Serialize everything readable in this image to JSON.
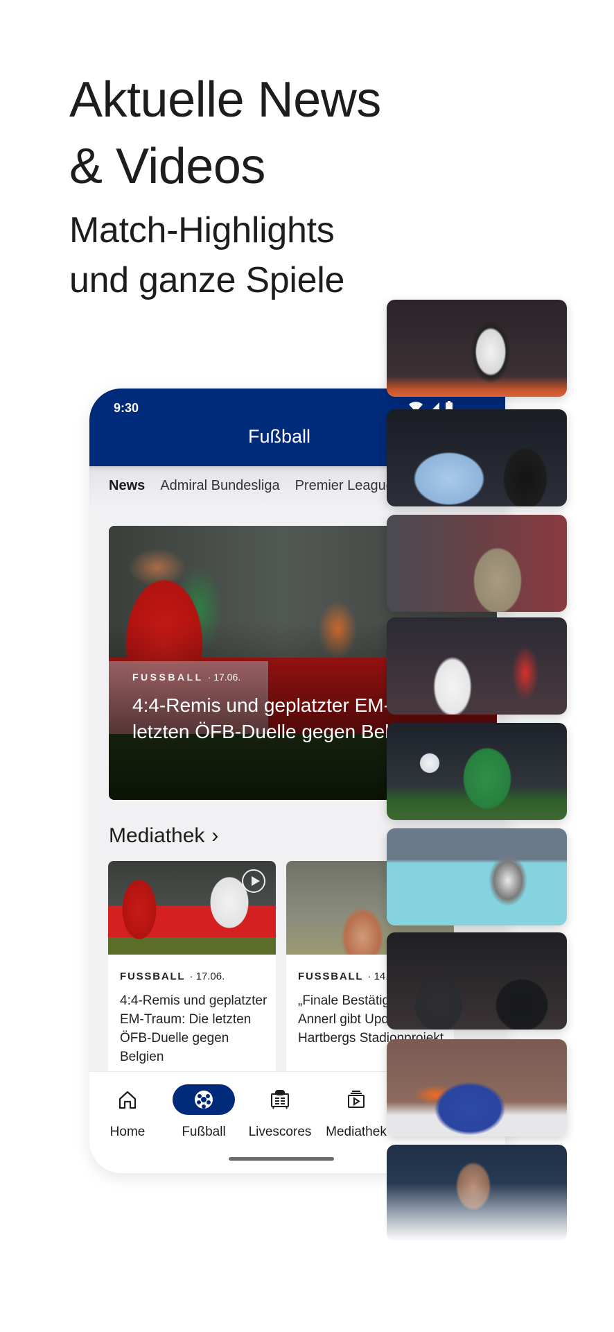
{
  "promo": {
    "title_lines": [
      "Aktuelle News",
      "& Videos"
    ],
    "subtitle_lines": [
      "Match-Highlights",
      "und ganze Spiele"
    ]
  },
  "phone": {
    "status_time": "9:30",
    "status_icons": [
      "wifi-icon",
      "signal-icon",
      "battery-icon"
    ],
    "header_title": "Fußball",
    "tabs": [
      {
        "label": "News",
        "active": true
      },
      {
        "label": "Admiral Bundesliga",
        "active": false
      },
      {
        "label": "Premier League",
        "active": false
      }
    ],
    "hero": {
      "category": "FUSSBALL",
      "date": "· 17.06.",
      "headline": "4:4-Remis und geplatzter EM-Traum: Die letzten ÖFB-Duelle gegen Belgien"
    },
    "mediathek": {
      "heading": "Mediathek",
      "chevron": "›",
      "cards": [
        {
          "category": "FUSSBALL",
          "date": "· 17.06.",
          "title": "4:4-Remis und geplatzter EM-Traum: Die letzten ÖFB-Duelle gegen Belgien",
          "has_play_icon": true
        },
        {
          "category": "FUSSBALL",
          "date": "· 14.",
          "title": "„Finale Bestätigung fehlt: Annerl gibt Update zu Hartbergs Stadionprojekt",
          "has_play_icon": false
        }
      ]
    },
    "bottom_nav": [
      {
        "label": "Home",
        "icon": "home-icon",
        "active": false
      },
      {
        "label": "Fußball",
        "icon": "football-icon",
        "active": true
      },
      {
        "label": "Livescores",
        "icon": "livescores-icon",
        "active": false
      },
      {
        "label": "Mediathek",
        "icon": "mediathek-icon",
        "active": false
      }
    ]
  },
  "thumbnails": [
    {
      "subject": "Football player in black-and-white striped jersey"
    },
    {
      "subject": "Players in light-blue jerseys arguing with referee"
    },
    {
      "subject": "Coach in beige sweater"
    },
    {
      "subject": "Player in white-black striped jersey"
    },
    {
      "subject": "Players in green and blue jerseys with ball"
    },
    {
      "subject": "Tennis player hitting forehand"
    },
    {
      "subject": "Two men in black jackets in stands"
    },
    {
      "subject": "Ice hockey players in blue-orange jerseys"
    },
    {
      "subject": "Close-up of player face"
    }
  ],
  "colors": {
    "brand_blue": "#002a7a",
    "content_bg": "#f1f1f3",
    "text_dark": "#1c1c1c"
  }
}
